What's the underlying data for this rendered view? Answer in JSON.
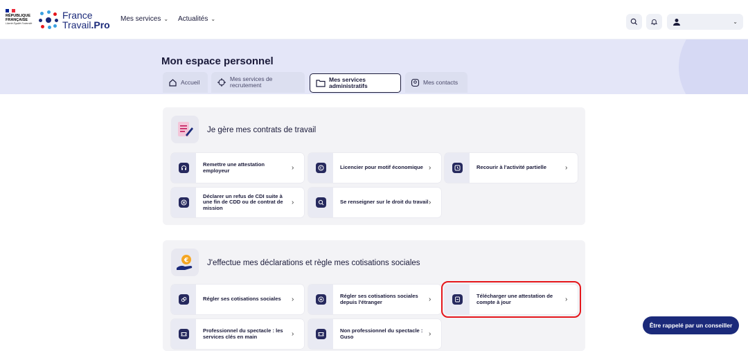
{
  "header": {
    "gov_line1": "RÉPUBLIQUE",
    "gov_line2": "FRANÇAISE",
    "gov_motto": "Liberté Égalité Fraternité",
    "brand_line1": "France",
    "brand_line2": "Travail",
    "brand_suffix": ".Pro",
    "nav": [
      {
        "label": "Mes services"
      },
      {
        "label": "Actualités"
      }
    ]
  },
  "page": {
    "title": "Mon espace personnel"
  },
  "tabs": [
    {
      "label": "Accueil"
    },
    {
      "label": "Mes services de recrutement"
    },
    {
      "label": "Mes services administratifs"
    },
    {
      "label": "Mes contacts"
    }
  ],
  "sections": [
    {
      "title": "Je gère mes contrats de travail",
      "cards": [
        {
          "label": "Remettre une attestation employeur"
        },
        {
          "label": "Licencier pour motif économique"
        },
        {
          "label": "Recourir à l'activité partielle"
        },
        {
          "label": "Déclarer un refus de CDI suite à une fin de CDD ou de contrat de mission"
        },
        {
          "label": "Se renseigner sur le droit du travail"
        }
      ]
    },
    {
      "title": "J'effectue mes déclarations et règle mes cotisations sociales",
      "cards": [
        {
          "label": "Régler ses cotisations sociales"
        },
        {
          "label": "Régler ses cotisations sociales depuis l'étranger"
        },
        {
          "label": "Télécharger une attestation de compte à jour"
        },
        {
          "label": "Professionnel du spectacle : les services clés en main"
        },
        {
          "label": "Non professionnel du spectacle : Guso"
        }
      ]
    }
  ],
  "callback_button": "Être rappelé par un conseiller",
  "colors": {
    "brand": "#1b2a7a",
    "banner": "#e4e6f8",
    "highlight": "#e5161b"
  }
}
